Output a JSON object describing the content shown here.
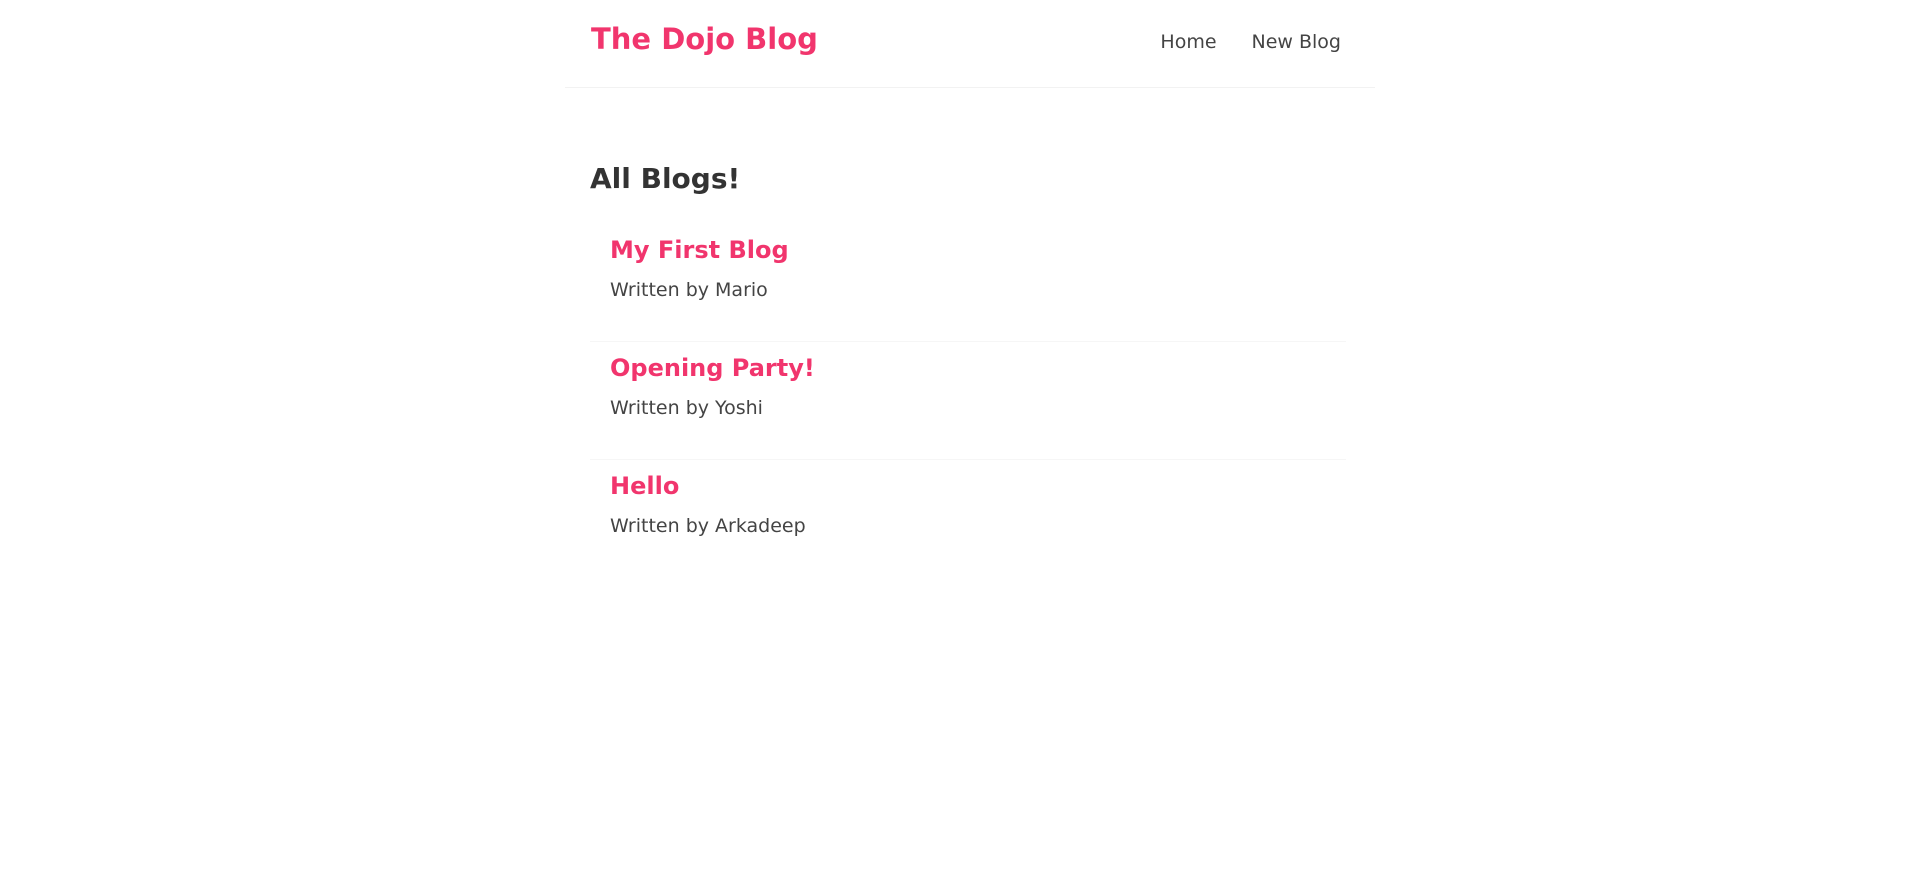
{
  "navbar": {
    "brand": "The Dojo Blog",
    "links": [
      {
        "label": "Home"
      },
      {
        "label": "New Blog"
      }
    ]
  },
  "main": {
    "title": "All Blogs!",
    "blogs": [
      {
        "title": "My First Blog",
        "author": "Written by Mario"
      },
      {
        "title": "Opening Party!",
        "author": "Written by Yoshi"
      },
      {
        "title": "Hello",
        "author": "Written by Arkadeep"
      }
    ]
  },
  "colors": {
    "accent": "#f1356d",
    "text": "#333333",
    "muted_text": "#444444",
    "divider": "#f2f2f2"
  }
}
